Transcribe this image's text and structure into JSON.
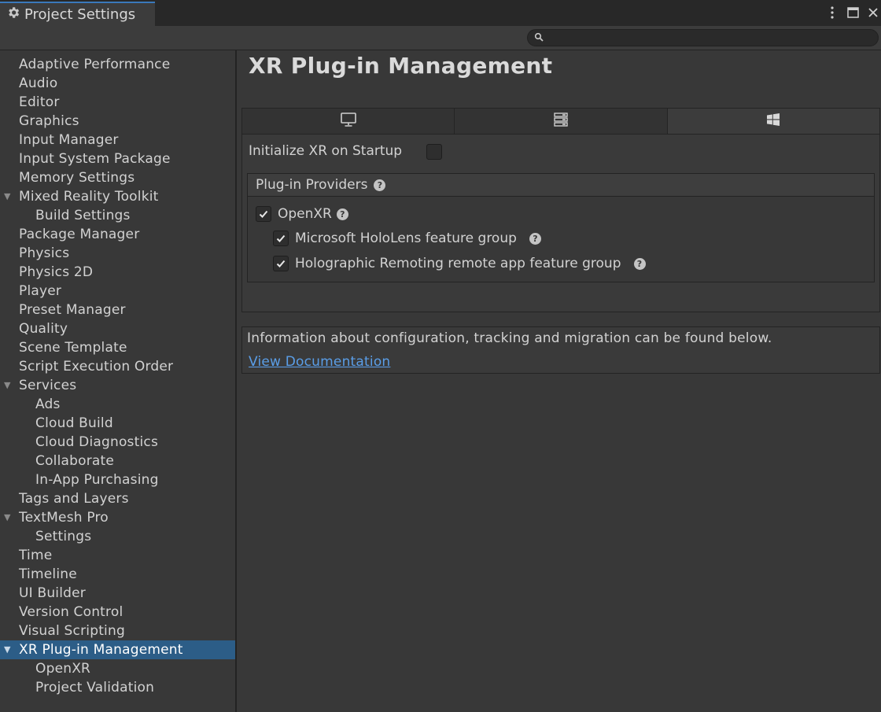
{
  "window": {
    "tab_title": "Project Settings",
    "icons": {
      "tab": "gear-icon",
      "menu": "kebab-menu-icon",
      "maximize": "maximize-icon",
      "close": "close-icon"
    }
  },
  "search": {
    "value": "",
    "placeholder": "",
    "icon": "search-icon"
  },
  "sidebar": {
    "items": [
      {
        "label": "Adaptive Performance",
        "level": 0
      },
      {
        "label": "Audio",
        "level": 0
      },
      {
        "label": "Editor",
        "level": 0
      },
      {
        "label": "Graphics",
        "level": 0
      },
      {
        "label": "Input Manager",
        "level": 0
      },
      {
        "label": "Input System Package",
        "level": 0
      },
      {
        "label": "Memory Settings",
        "level": 0
      },
      {
        "label": "Mixed Reality Toolkit",
        "level": 0,
        "expanded": true
      },
      {
        "label": "Build Settings",
        "level": 1
      },
      {
        "label": "Package Manager",
        "level": 0
      },
      {
        "label": "Physics",
        "level": 0
      },
      {
        "label": "Physics 2D",
        "level": 0
      },
      {
        "label": "Player",
        "level": 0
      },
      {
        "label": "Preset Manager",
        "level": 0
      },
      {
        "label": "Quality",
        "level": 0
      },
      {
        "label": "Scene Template",
        "level": 0
      },
      {
        "label": "Script Execution Order",
        "level": 0
      },
      {
        "label": "Services",
        "level": 0,
        "expanded": true
      },
      {
        "label": "Ads",
        "level": 1
      },
      {
        "label": "Cloud Build",
        "level": 1
      },
      {
        "label": "Cloud Diagnostics",
        "level": 1
      },
      {
        "label": "Collaborate",
        "level": 1
      },
      {
        "label": "In-App Purchasing",
        "level": 1
      },
      {
        "label": "Tags and Layers",
        "level": 0
      },
      {
        "label": "TextMesh Pro",
        "level": 0,
        "expanded": true
      },
      {
        "label": "Settings",
        "level": 1
      },
      {
        "label": "Time",
        "level": 0
      },
      {
        "label": "Timeline",
        "level": 0
      },
      {
        "label": "UI Builder",
        "level": 0
      },
      {
        "label": "Version Control",
        "level": 0
      },
      {
        "label": "Visual Scripting",
        "level": 0
      },
      {
        "label": "XR Plug-in Management",
        "level": 0,
        "expanded": true,
        "selected": true
      },
      {
        "label": "OpenXR",
        "level": 1
      },
      {
        "label": "Project Validation",
        "level": 1
      }
    ]
  },
  "main": {
    "title": "XR Plug-in Management",
    "platform_tabs": [
      {
        "icon": "desktop-monitor-icon",
        "selected": false
      },
      {
        "icon": "server-icon",
        "selected": false
      },
      {
        "icon": "windows-logo-icon",
        "selected": true
      }
    ],
    "init_on_startup": {
      "label": "Initialize XR on Startup",
      "checked": false
    },
    "providers": {
      "header": "Plug-in Providers",
      "items": [
        {
          "label": "OpenXR",
          "checked": true
        },
        {
          "label": "Microsoft HoloLens feature group",
          "checked": true
        },
        {
          "label": "Holographic Remoting remote app feature group",
          "checked": true
        }
      ]
    },
    "info": {
      "text": "Information about configuration, tracking and migration can be found below.",
      "link": "View Documentation"
    }
  },
  "colors": {
    "selection": "#2c5d87",
    "link": "#5a9ee8",
    "tab_accent": "#3a79bb",
    "background": "#383838"
  }
}
